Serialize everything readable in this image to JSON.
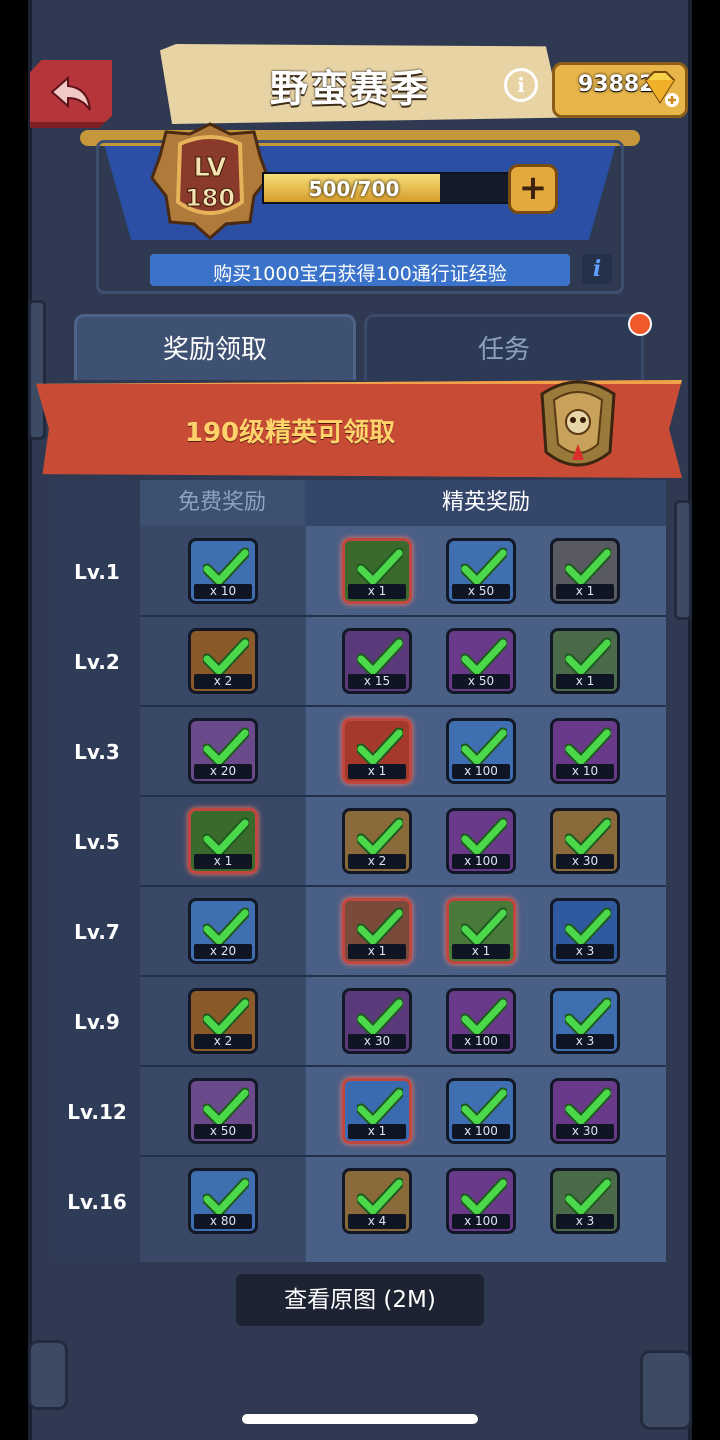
{
  "header": {
    "title": "野蛮赛季",
    "gems": "93882",
    "level_badge_top": "LV",
    "level_badge_num": "180",
    "xp_text": "500/700",
    "xp_progress": 0.714,
    "promo": "购买1000宝石获得100通行证经验",
    "info_letter": "i",
    "plus_label": "+"
  },
  "tabs": [
    {
      "label": "奖励领取",
      "active": true
    },
    {
      "label": "任务",
      "active": false
    }
  ],
  "elite_banner": "190级精英可领取",
  "table": {
    "free_header": "免费奖励",
    "elite_header": "精英奖励",
    "rows": [
      {
        "lv": "Lv.1",
        "free": {
          "count": "x 10",
          "color": "#3f6fb0"
        },
        "elite": [
          {
            "count": "x 1",
            "color": "#3a6b2c",
            "glow": true
          },
          {
            "count": "x 50",
            "color": "#3f6fb0"
          },
          {
            "count": "x 1",
            "color": "#5a5a62"
          }
        ]
      },
      {
        "lv": "Lv.2",
        "free": {
          "count": "x 2",
          "color": "#8a5a2a"
        },
        "elite": [
          {
            "count": "x 15",
            "color": "#5a3a7a"
          },
          {
            "count": "x 50",
            "color": "#6a3a8a"
          },
          {
            "count": "x 1",
            "color": "#4a6a4a"
          }
        ]
      },
      {
        "lv": "Lv.3",
        "free": {
          "count": "x 20",
          "color": "#6a4a8a"
        },
        "elite": [
          {
            "count": "x 1",
            "color": "#a63a2a",
            "glow": true
          },
          {
            "count": "x 100",
            "color": "#3f6fb0"
          },
          {
            "count": "x 10",
            "color": "#6a3a8a"
          }
        ]
      },
      {
        "lv": "Lv.5",
        "free": {
          "count": "x 1",
          "color": "#3a6b2c",
          "glow": true
        },
        "elite": [
          {
            "count": "x 2",
            "color": "#8a6a3a"
          },
          {
            "count": "x 100",
            "color": "#6a3a8a"
          },
          {
            "count": "x 30",
            "color": "#8a6a3a"
          }
        ]
      },
      {
        "lv": "Lv.7",
        "free": {
          "count": "x 20",
          "color": "#3f6fb0"
        },
        "elite": [
          {
            "count": "x 1",
            "color": "#7a4a3a",
            "glow": true
          },
          {
            "count": "x 1",
            "color": "#4a7a3a",
            "glow": true
          },
          {
            "count": "x 3",
            "color": "#2f5aa0"
          }
        ]
      },
      {
        "lv": "Lv.9",
        "free": {
          "count": "x 2",
          "color": "#8a5a2a"
        },
        "elite": [
          {
            "count": "x 30",
            "color": "#5a3a7a"
          },
          {
            "count": "x 100",
            "color": "#6a3a8a"
          },
          {
            "count": "x 3",
            "color": "#3f6fb0"
          }
        ]
      },
      {
        "lv": "Lv.12",
        "free": {
          "count": "x 50",
          "color": "#6a4a8a"
        },
        "elite": [
          {
            "count": "x 1",
            "color": "#3a6ab0",
            "glow": true
          },
          {
            "count": "x 100",
            "color": "#3f6fb0"
          },
          {
            "count": "x 30",
            "color": "#6a3a8a"
          }
        ]
      },
      {
        "lv": "Lv.16",
        "free": {
          "count": "x 80",
          "color": "#3f6fb0"
        },
        "elite": [
          {
            "count": "x 4",
            "color": "#8a6a3a"
          },
          {
            "count": "x 100",
            "color": "#6a3a8a"
          },
          {
            "count": "x 3",
            "color": "#4a6a4a"
          }
        ]
      }
    ]
  },
  "toast": "查看原图 (2M)",
  "colors": {
    "check": "#4bd94b",
    "panel": "#2f3a52",
    "elite_banner": "#c84b35"
  }
}
